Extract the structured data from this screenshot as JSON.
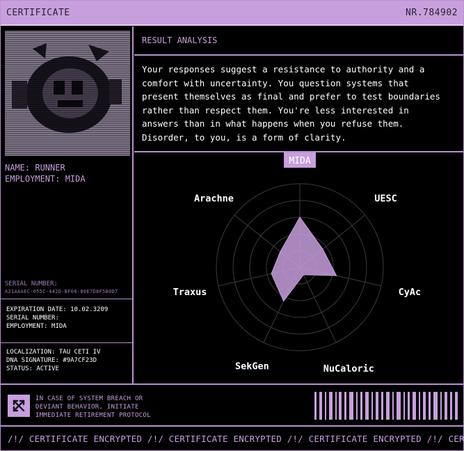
{
  "header": {
    "title": "CERTIFICATE",
    "number": "NR.784902"
  },
  "profile": {
    "name_line": "NAME: RUNNER",
    "employment_line": "EMPLOYMENT: MIDA",
    "serial_label": "SERIAL NUMBER:",
    "serial_code": "A21AAAEC-055C-442D-BF00-80E7D8F580D7"
  },
  "details_1": {
    "expiration": "EXPIRATION DATE: 10.02.3209",
    "serial": "SERIAL NUMBER:",
    "employment": "EMPLOYMENT: MIDA"
  },
  "details_2": {
    "localization": "LOCALIZATION: TAU CETI IV",
    "dna": "DNA SIGNATURE: #9A7CF23D",
    "status": "STATUS: ACTIVE"
  },
  "result": {
    "heading": "RESULT ANALYSIS",
    "text": "Your responses suggest a resistance to authority and a comfort with uncertainty. You question systems that present themselves as final and prefer to test boundaries rather than respect them. You're less interested in answers than in what happens when you refuse them. Disorder, to you, is a form of clarity."
  },
  "chart_data": {
    "type": "radar",
    "axes": [
      "MIDA",
      "UESC",
      "CyAc",
      "NuCaloric",
      "SekGen",
      "Traxus",
      "Arachne"
    ],
    "highlighted_axis": "MIDA",
    "values": [
      0.6,
      0.35,
      0.45,
      0.1,
      0.45,
      0.35,
      0.3
    ],
    "max": 1,
    "rings": 5,
    "fill_color": "#c79fdd"
  },
  "warning": {
    "line1": "IN CASE OF SYSTEM BREACH OR",
    "line2": "DEVIANT BEHAVIOR, INITIATE",
    "line3": "IMMEDIATE RETIREMENT PROTOCOL",
    "icon": "crossed-arrows-icon"
  },
  "ticker": {
    "text": "/!/ CERTIFICATE ENCRYPTED /!/ CERTIFICATE ENCRYPTED /!/ CERTIFICATE ENCRYPTED /!/ CERTIFICATE ENCRYPTED"
  },
  "colors": {
    "accent": "#c79fdd",
    "background": "#000000",
    "text": "#ffffff"
  }
}
